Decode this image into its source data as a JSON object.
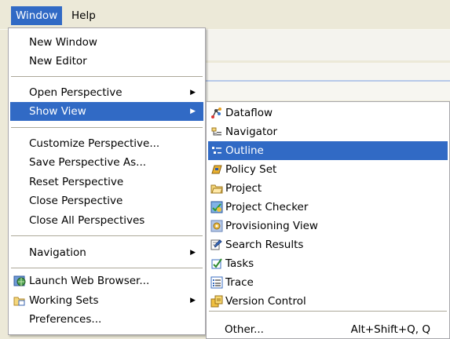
{
  "menubar": {
    "window": "Window",
    "help": "Help"
  },
  "window_menu": {
    "new_window": "New Window",
    "new_editor": "New Editor",
    "open_perspective": "Open Perspective",
    "show_view": "Show View",
    "customize_perspective": "Customize Perspective...",
    "save_perspective_as": "Save Perspective As...",
    "reset_perspective": "Reset Perspective",
    "close_perspective": "Close Perspective",
    "close_all_perspectives": "Close All Perspectives",
    "navigation": "Navigation",
    "launch_web_browser": "Launch Web Browser...",
    "working_sets": "Working Sets",
    "preferences": "Preferences..."
  },
  "show_view_menu": {
    "dataflow": "Dataflow",
    "navigator": "Navigator",
    "outline": "Outline",
    "policy_set": "Policy Set",
    "project": "Project",
    "project_checker": "Project Checker",
    "provisioning_view": "Provisioning View",
    "search_results": "Search Results",
    "tasks": "Tasks",
    "trace": "Trace",
    "version_control": "Version Control",
    "other": "Other...",
    "other_shortcut": "Alt+Shift+Q, Q"
  },
  "colors": {
    "selection": "#316ac5",
    "menu_bg": "#ffffff",
    "bar_bg": "#ece9d8"
  }
}
